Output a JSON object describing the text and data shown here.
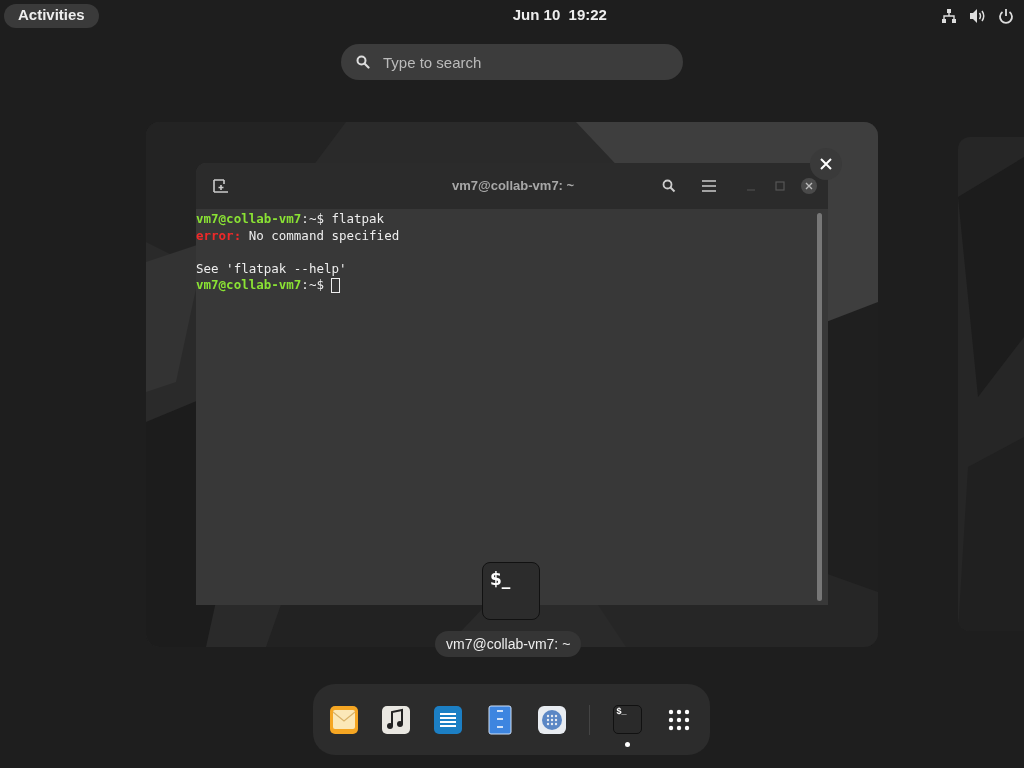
{
  "top_bar": {
    "activities": "Activities",
    "clock": "Jun 10  19:22",
    "status_icons": [
      {
        "kind": "network"
      },
      {
        "kind": "volume"
      },
      {
        "kind": "power"
      }
    ]
  },
  "search": {
    "placeholder": "Type to search"
  },
  "workspace": {
    "window": {
      "title": "vm7@collab-vm7: ~",
      "lines": [
        {
          "segments": [
            {
              "kind": "prompt",
              "text": "vm7@collab-vm7"
            },
            {
              "kind": "plain",
              "text": ":~$ flatpak"
            }
          ],
          "cursor": false
        },
        {
          "segments": [
            {
              "kind": "error",
              "text": "error:"
            },
            {
              "kind": "plain",
              "text": " No command specified"
            }
          ],
          "cursor": false
        },
        {
          "cursor": false
        },
        {
          "segments": [
            {
              "kind": "plain",
              "text": "See 'flatpak --help'"
            }
          ],
          "cursor": false
        },
        {
          "segments": [
            {
              "kind": "prompt",
              "text": "vm7@collab-vm7"
            },
            {
              "kind": "plain",
              "text": ":~$ "
            }
          ],
          "cursor": true
        }
      ]
    },
    "app_icon_glyph": "$_",
    "window_label": "vm7@collab-vm7: ~"
  },
  "dock": [
    {
      "kind": "mail",
      "running": false
    },
    {
      "kind": "music",
      "running": false
    },
    {
      "kind": "editor",
      "running": false
    },
    {
      "kind": "files",
      "running": false
    },
    {
      "kind": "software",
      "running": false
    },
    {
      "kind": "separator",
      "running": false
    },
    {
      "kind": "terminal",
      "glyph": "$_",
      "running": true
    },
    {
      "kind": "apps",
      "running": false
    }
  ]
}
